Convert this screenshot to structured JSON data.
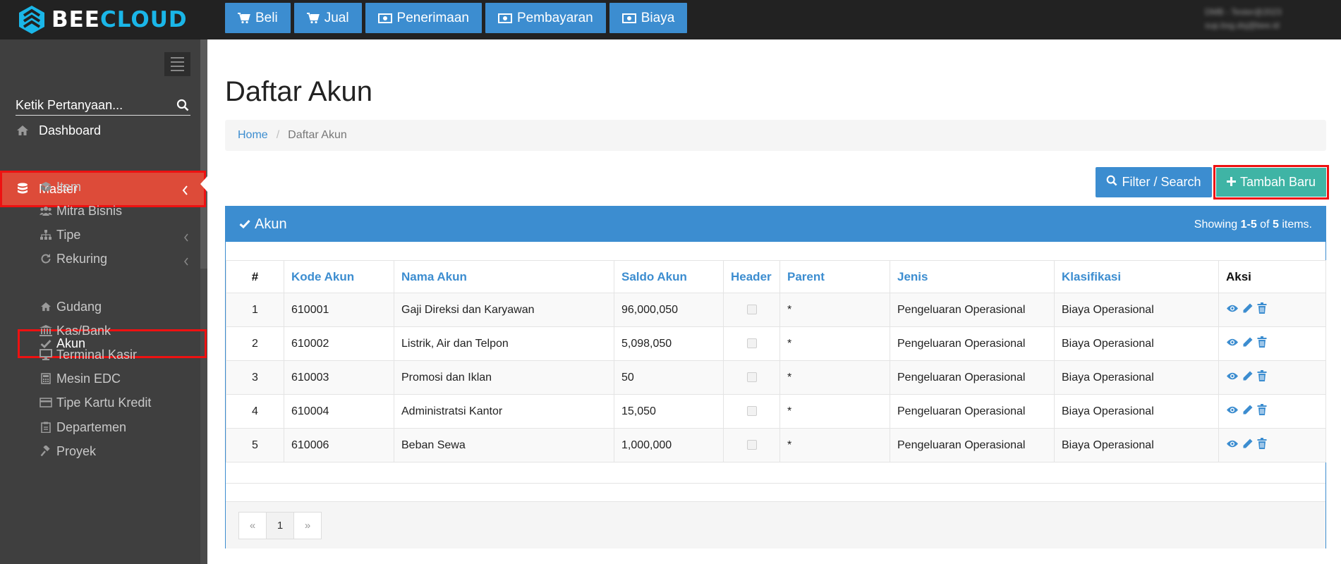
{
  "brand": {
    "part1": "BEE",
    "part2": "CLOUD"
  },
  "topnav": [
    {
      "label": "Beli"
    },
    {
      "label": "Jual"
    },
    {
      "label": "Penerimaan"
    },
    {
      "label": "Pembayaran"
    },
    {
      "label": "Biaya"
    }
  ],
  "user": {
    "line1": "DMB - Tester@2023",
    "line2": "sup.bsg.dsj@bee.id"
  },
  "sidebar": {
    "search_placeholder": "Ketik Pertanyaan...",
    "dashboard": "Dashboard",
    "master": "Master",
    "items": [
      {
        "label": "Item"
      },
      {
        "label": "Mitra Bisnis"
      },
      {
        "label": "Tipe"
      },
      {
        "label": "Rekuring"
      },
      {
        "label": "Akun"
      },
      {
        "label": "Gudang"
      },
      {
        "label": "Kas/Bank"
      },
      {
        "label": "Terminal Kasir"
      },
      {
        "label": "Mesin EDC"
      },
      {
        "label": "Tipe Kartu Kredit"
      },
      {
        "label": "Departemen"
      },
      {
        "label": "Proyek"
      }
    ]
  },
  "page": {
    "title": "Daftar Akun",
    "breadcrumb": {
      "home": "Home",
      "current": "Daftar Akun"
    },
    "filter_button": "Filter / Search",
    "add_button": "Tambah Baru"
  },
  "panel": {
    "title": "Akun",
    "summary": {
      "prefix": "Showing ",
      "range": "1-5",
      "mid": " of ",
      "total": "5",
      "suffix": " items."
    }
  },
  "table": {
    "headers": {
      "num": "#",
      "kode": "Kode Akun",
      "nama": "Nama Akun",
      "saldo": "Saldo Akun",
      "header": "Header",
      "parent": "Parent",
      "jenis": "Jenis",
      "klasifikasi": "Klasifikasi",
      "aksi": "Aksi"
    },
    "rows": [
      {
        "num": "1",
        "kode": "610001",
        "nama": "Gaji Direksi dan Karyawan",
        "saldo": "96,000,050",
        "parent": "*",
        "jenis": "Pengeluaran Operasional",
        "klasifikasi": "Biaya Operasional"
      },
      {
        "num": "2",
        "kode": "610002",
        "nama": "Listrik, Air dan Telpon",
        "saldo": "5,098,050",
        "parent": "*",
        "jenis": "Pengeluaran Operasional",
        "klasifikasi": "Biaya Operasional"
      },
      {
        "num": "3",
        "kode": "610003",
        "nama": "Promosi dan Iklan",
        "saldo": "50",
        "parent": "*",
        "jenis": "Pengeluaran Operasional",
        "klasifikasi": "Biaya Operasional"
      },
      {
        "num": "4",
        "kode": "610004",
        "nama": "Administratsi Kantor",
        "saldo": "15,050",
        "parent": "*",
        "jenis": "Pengeluaran Operasional",
        "klasifikasi": "Biaya Operasional"
      },
      {
        "num": "5",
        "kode": "610006",
        "nama": "Beban Sewa",
        "saldo": "1,000,000",
        "parent": "*",
        "jenis": "Pengeluaran Operasional",
        "klasifikasi": "Biaya Operasional"
      }
    ]
  },
  "pagination": {
    "prev": "«",
    "page": "1",
    "next": "»"
  },
  "colors": {
    "topbar": "#222222",
    "sidebar": "#3f3f3f",
    "primary": "#3c8dd0",
    "success": "#3fb4a5",
    "master_active": "#dd4b39",
    "highlight_border": "#ee1111",
    "brand_cloud": "#1ab6e8"
  },
  "icons": {
    "topnav": [
      "cart-icon",
      "cart-icon",
      "money-icon",
      "money-icon",
      "money-icon"
    ],
    "row_actions": [
      "eye-icon",
      "pencil-icon",
      "trash-icon"
    ]
  }
}
